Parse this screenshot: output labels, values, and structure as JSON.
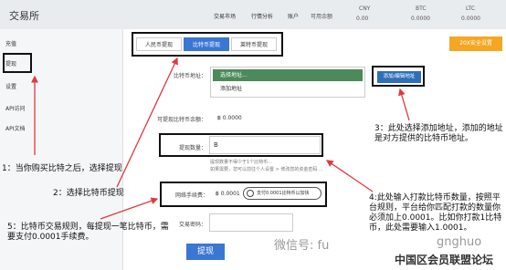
{
  "header": {
    "logo": "交易所",
    "nav": [
      "交易市场",
      "行情分析",
      "账户"
    ],
    "tickers": [
      {
        "label": "可用余额",
        "value": ""
      },
      {
        "label": "CNY",
        "value": "0.00"
      },
      {
        "label": "BTC",
        "value": "0.0000"
      },
      {
        "label": "LTC",
        "value": "0.0000"
      }
    ]
  },
  "sidebar": {
    "items": [
      "充值",
      "提现",
      "设置",
      "API访问",
      "API文档"
    ]
  },
  "tabs": [
    "人民币提现",
    "比特币提现",
    "莱特币提现"
  ],
  "orange_button": "20X安全设置",
  "form": {
    "addr_label": "比特币地址：",
    "addr_option1": "选择地址...",
    "addr_option2": "添加地址",
    "add_addr_btn": "添加/编辑地址",
    "available_label": "可提现比特币余额：",
    "available_value": "฿ 0.0000",
    "amount_label": "提现数量：",
    "amount_value": "B",
    "hint1": "提现数量不得少于1个比特币...",
    "hint2": "如果需要，您可以前往个人设置 > 修改您的资金密码 ...",
    "fee_label": "网络手续费：",
    "fee_value": "฿ 0.0001",
    "fee_pill": "支付0.0001比特币以加快",
    "password_label": "交易密码：",
    "submit": "提现"
  },
  "annotations": {
    "a1": "1：当你购买比特之后，选择提现",
    "a2": "2：选择比特币提现",
    "a3": "3：此处选择添加地址，添加的地址是对方提供的比特币地址。",
    "a4": "4:此处输入打款比特币数量，按照平台规则，平台给你匹配打款的数量你必须加上0.0001。比如你打款1比特币，此处需要输入1.0001。",
    "a5": "5：比特币交易规则，每提现一笔比特币，需要支付0.0001手续费。"
  },
  "watermark": "微信号: fu",
  "watermark2": "gnghuo",
  "corner_text": "中国区会员联盟论坛"
}
